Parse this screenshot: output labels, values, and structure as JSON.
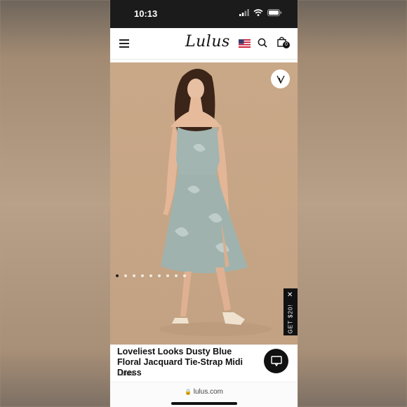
{
  "status_bar": {
    "time": "10:13"
  },
  "header": {
    "logo": "Lulus",
    "cart_count": "0"
  },
  "promo": {
    "label": "GET $20!",
    "close_symbol": "✕"
  },
  "carousel": {
    "total": 9,
    "active": 1
  },
  "product": {
    "title": "Loveliest Looks Dusty Blue Floral Jacquard Tie-Strap Midi Dress",
    "brand": "Lulus"
  },
  "browser": {
    "url": "lulus.com"
  },
  "colors": {
    "dress": "#9fb2ad",
    "backdrop": "#c6a586",
    "accent": "#111111"
  }
}
